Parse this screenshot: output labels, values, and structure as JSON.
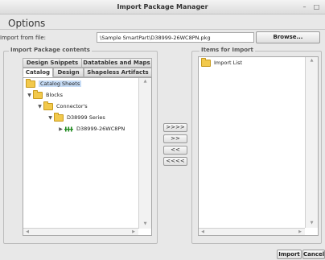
{
  "window": {
    "title": "Import Package Manager"
  },
  "options_heading": "Options",
  "import_from": {
    "label": "Import from file:",
    "value": "\\Sample SmartPart\\D38999-26WC8PN.pkg",
    "browse_label": "Browse..."
  },
  "left_panel": {
    "title": "Import Package contents",
    "tabs_row1": [
      "Design Snippets",
      "Datatables and Maps"
    ],
    "tabs_row2": [
      "Catalog",
      "Design",
      "Shapeless Artifacts"
    ],
    "active_tab": "Catalog",
    "tree": [
      {
        "label": "Catalog Sheets",
        "depth": 0,
        "icon": "folder-icon",
        "selected": true
      },
      {
        "label": "Blocks",
        "depth": 1,
        "icon": "folder-icon",
        "expanded": true
      },
      {
        "label": "Connector's",
        "depth": 2,
        "icon": "folder-icon",
        "expanded": true
      },
      {
        "label": "D38999 Series",
        "depth": 3,
        "icon": "folder-icon",
        "expanded": true
      },
      {
        "label": "D38999-26WC8PN",
        "depth": 4,
        "icon": "connector-icon",
        "collapsed": true
      }
    ]
  },
  "transfer_buttons": [
    ">>>>",
    ">>",
    "<<",
    "<<<<"
  ],
  "right_panel": {
    "title": "Items for Import",
    "tree": [
      {
        "label": "Import List",
        "icon": "folder-icon"
      }
    ]
  },
  "footer": {
    "import_label": "Import",
    "cancel_label": "Cancel"
  },
  "colors": {
    "selection": "#c6dcf6",
    "folder": "#f2c94c",
    "connector": "#1e8a1e"
  }
}
